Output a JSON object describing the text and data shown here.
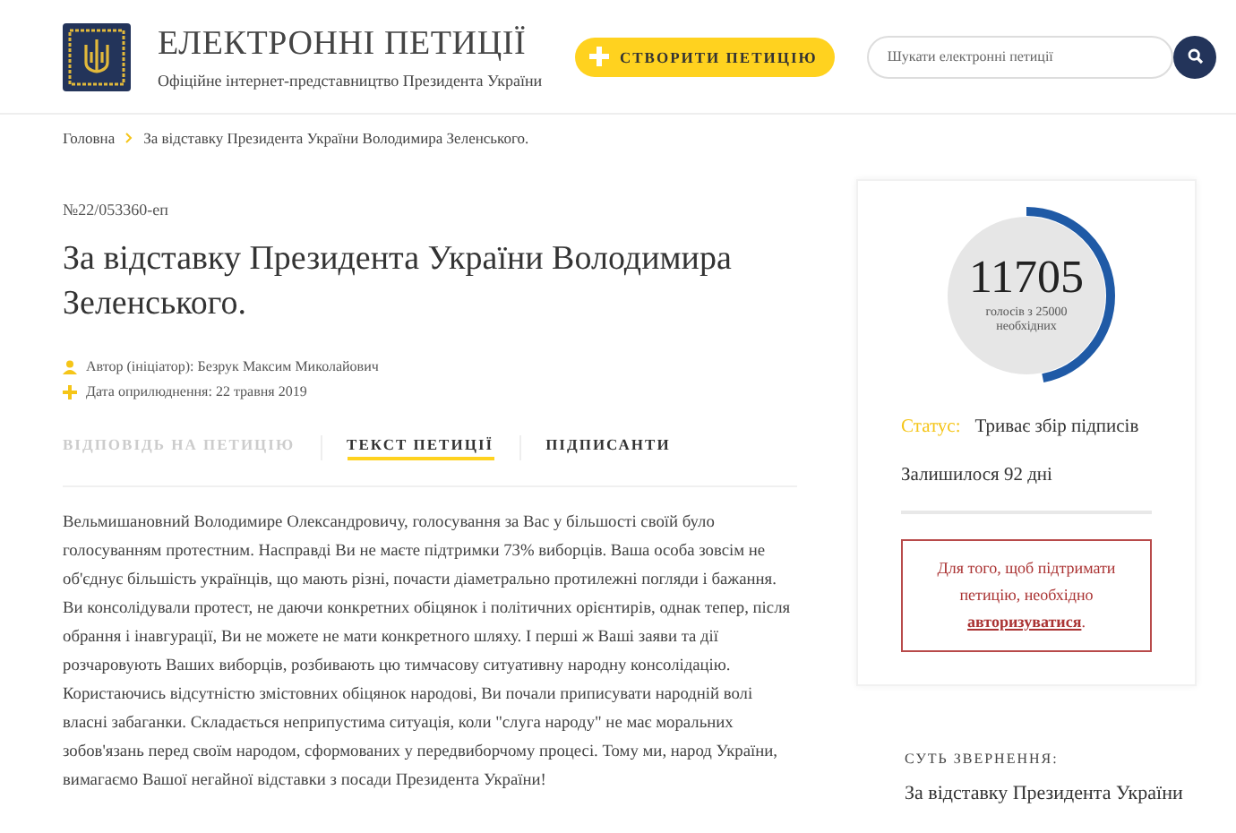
{
  "header": {
    "title": "ЕЛЕКТРОННІ ПЕТИЦІЇ",
    "subtitle": "Офіційне інтернет-представництво Президента України",
    "create_button": "СТВОРИТИ ПЕТИЦІЮ",
    "search": {
      "placeholder": "Шукати електронні петиції"
    }
  },
  "breadcrumbs": [
    "Головна",
    "За відставку Президента України Володимира Зеленського."
  ],
  "petition": {
    "number": "№22/053360-еп",
    "title": "За відставку Президента України Володимира Зеленського.",
    "meta": [
      {
        "kind": "author",
        "text": "Автор (ініціатор): Безрук Максим Миколайович"
      },
      {
        "kind": "date",
        "text": "Дата оприлюднення: 22 травня 2019"
      }
    ],
    "tabs": [
      {
        "label": "ВІДПОВІДЬ НА ПЕТИЦІЮ",
        "selected": false,
        "disabled": true
      },
      {
        "label": "ТЕКСТ ПЕТИЦІЇ",
        "selected": true,
        "disabled": false
      },
      {
        "label": "ПІДПИСАНТИ",
        "selected": false,
        "disabled": false
      }
    ],
    "text": "Вельмишановний Володимире Олександровичу, голосування за Вас у більшості своїй було голосуванням протестним. Насправді Ви не маєте підтримки 73% виборців. Ваша особа зовсім не об'єднує більшість українців, що мають різні, почасти діаметрально протилежні погляди і бажання. Ви консолідували протест, не даючи конкретних обіцянок і політичних орієнтирів, однак тепер, після обрання і інавгурації, Ви не можете не мати конкретного шляху. І перші ж Ваші заяви та дії розчаровують Ваших виборців, розбивають цю тимчасову ситуативну народну консолідацію. Користаючись відсутністю змістовних обіцянок народові, Ви почали приписувати народній волі власні забаганки. Складається неприпустима ситуація, коли \"слуга народу\" не має моральних зобов'язань перед своїм народом, сформованих у передвиборчому процесі. Тому ми, народ України, вимагаємо Вашої негайної відставки з посади Президента України!"
  },
  "sidebar": {
    "votes": {
      "count": "11705",
      "caption": "голосів з 25000 необхідних",
      "level": 0.468
    },
    "status_label": "Статус:",
    "status": "Триває збір підписів",
    "remaining": "Залишилося 92 дні",
    "notice": {
      "before": "Для того, щоб підтримати петицію, необхідно",
      "link": "авторизуватися",
      "after": "."
    },
    "essence_label": "СУТЬ ЗВЕРНЕННЯ:",
    "essence": "За відставку Президента України"
  }
}
